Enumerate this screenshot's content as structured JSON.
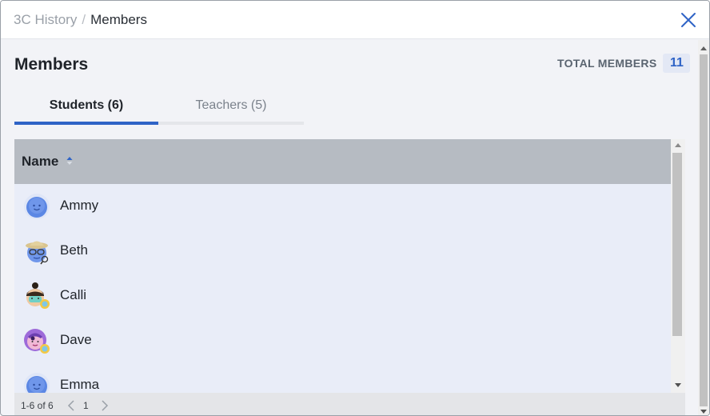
{
  "header": {
    "breadcrumb_parent": "3C History",
    "breadcrumb_separator": "/",
    "breadcrumb_current": "Members",
    "close_icon": "close-icon"
  },
  "main": {
    "title": "Members",
    "total_label": "TOTAL MEMBERS",
    "total_count": "11"
  },
  "tabs": [
    {
      "label": "Students (6)",
      "active": true
    },
    {
      "label": "Teachers (5)",
      "active": false
    }
  ],
  "table": {
    "column_header": "Name",
    "sort": "ascending",
    "rows": [
      {
        "name": "Ammy",
        "avatar": "blue-smiley-avatar"
      },
      {
        "name": "Beth",
        "avatar": "explorer-hat-glasses-avatar"
      },
      {
        "name": "Calli",
        "avatar": "bun-hair-badge-avatar"
      },
      {
        "name": "Dave",
        "avatar": "purple-hair-badge-avatar"
      },
      {
        "name": "Emma",
        "avatar": "blue-smiley-avatar"
      }
    ]
  },
  "pagination": {
    "range": "1-6 of 6",
    "page": "1"
  },
  "colors": {
    "accent": "#2e63c6",
    "table_header": "#b6bbc2",
    "table_body": "#e9edf8",
    "page_bg": "#f2f3f7"
  }
}
